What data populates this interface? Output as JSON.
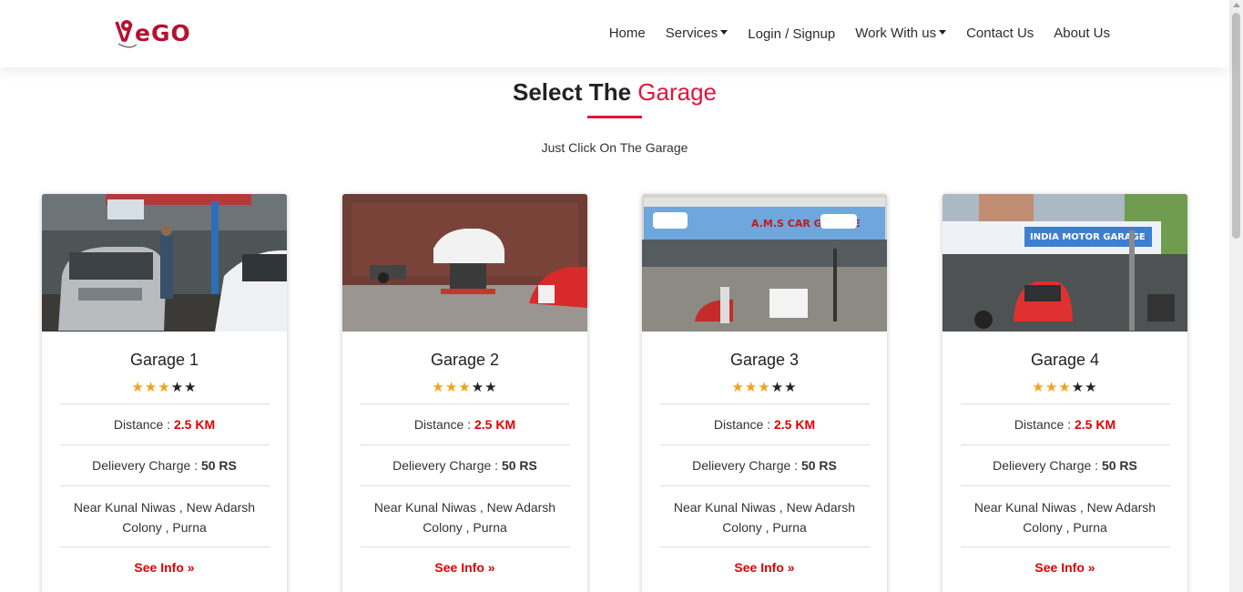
{
  "brand": {
    "name": "eGO",
    "color": "#b5122f"
  },
  "nav": {
    "items": [
      {
        "label": "Home",
        "dropdown": false
      },
      {
        "label": "Services",
        "dropdown": true
      },
      {
        "label": "Login / Signup",
        "dropdown": false
      },
      {
        "label": "Work With us",
        "dropdown": true
      },
      {
        "label": "Contact Us",
        "dropdown": false
      },
      {
        "label": "About Us",
        "dropdown": false
      }
    ]
  },
  "section": {
    "title_main": "Select The",
    "title_accent": "Garage",
    "subtitle": "Just Click On The Garage",
    "accent_color": "#e0163c"
  },
  "cards": [
    {
      "name": "Garage 1",
      "rating": 3,
      "max_rating": 5,
      "distance_label": "Distance :",
      "distance": "2.5 KM",
      "charge_label": "Delievery Charge :",
      "charge": "50 RS",
      "address": "Near Kunal Niwas , New Adarsh Colony , Purna",
      "link": "See Info",
      "link_icon": "double-chevron-right-icon"
    },
    {
      "name": "Garage 2",
      "rating": 3,
      "max_rating": 5,
      "distance_label": "Distance :",
      "distance": "2.5 KM",
      "charge_label": "Delievery Charge :",
      "charge": "50 RS",
      "address": "Near Kunal Niwas , New Adarsh Colony , Purna",
      "link": "See Info",
      "link_icon": "double-chevron-right-icon"
    },
    {
      "name": "Garage 3",
      "rating": 3,
      "max_rating": 5,
      "distance_label": "Distance :",
      "distance": "2.5 KM",
      "charge_label": "Delievery Charge :",
      "charge": "50 RS",
      "address": "Near Kunal Niwas , New Adarsh Colony , Purna",
      "link": "See Info",
      "link_icon": "double-chevron-right-icon"
    },
    {
      "name": "Garage 4",
      "rating": 3,
      "max_rating": 5,
      "distance_label": "Distance :",
      "distance": "2.5 KM",
      "charge_label": "Delievery Charge :",
      "charge": "50 RS",
      "address": "Near Kunal Niwas , New Adarsh Colony , Purna",
      "link": "See Info",
      "link_icon": "double-chevron-right-icon"
    }
  ]
}
